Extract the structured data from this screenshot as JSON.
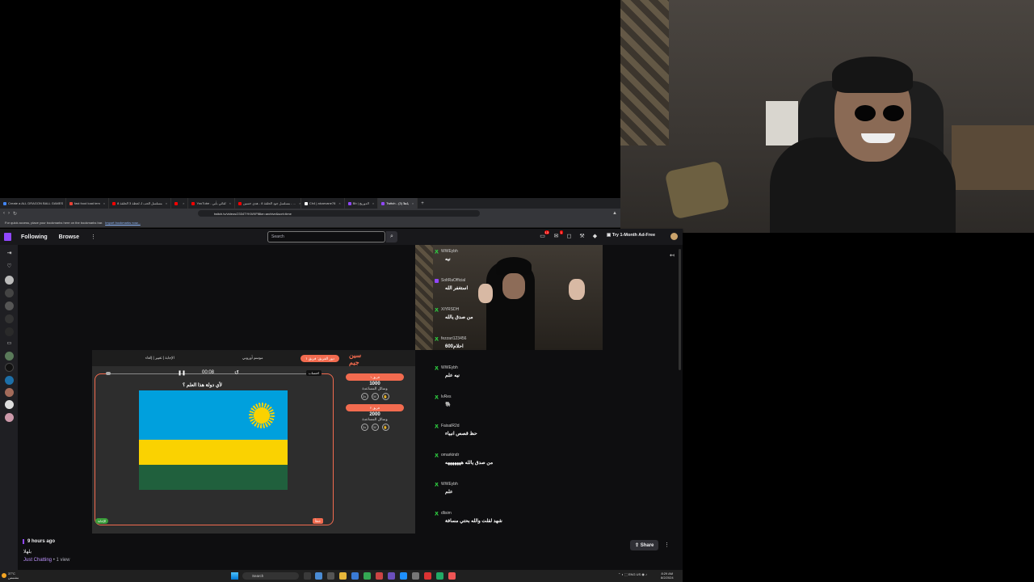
{
  "browser": {
    "tabs": [
      {
        "label": "Create a ALL DRAGON BALL GAMES",
        "color": "#4285f4",
        "active": false
      },
      {
        "label": "fast food load tem",
        "color": "#e94235",
        "active": false
      },
      {
        "label": "مسلسل الحب لـ لحظة 3 الحلقة 8",
        "color": "#ff0000",
        "active": false
      },
      {
        "label": "",
        "color": "#ff0000",
        "active": false
      },
      {
        "label": "YouTube - لقائي بأبي",
        "color": "#ff0000",
        "active": false
      },
      {
        "label": "مسلسل جود الحلقة 8 - هدى حسين - ...",
        "color": "#ff0000",
        "active": false
      },
      {
        "label": "Ch4 | alcarvane78",
        "color": "#ffffff",
        "active": false
      },
      {
        "label": "Bb | الدوريج",
        "color": "#9147ff",
        "active": false
      },
      {
        "label": "Twitch - ياهلا (3)",
        "color": "#9147ff",
        "active": true
      }
    ],
    "url": "twitch.tv/videos/2334TYKWXFf8ke=archive&sort=time",
    "bookmark_hint": "For quick access, place your bookmarks here on the bookmarks bar.",
    "bookmark_link": "Import bookmarks now..."
  },
  "twitch": {
    "nav_following": "Following",
    "nav_browse": "Browse",
    "more_icon": "⋮",
    "search_placeholder": "Search",
    "notif_count_1": "13",
    "notif_count_2": "1",
    "adfree": "Try 1-Month Ad-Free",
    "brand_color": "#9147ff"
  },
  "game": {
    "logo": "سين جيم",
    "turn_pill": "دور الفريق: فريق ١",
    "episode": "موسم أوروبي",
    "options": "الإجابة | تغيير | إلغاء",
    "timer": "00:08",
    "timer_btn": "احتساب",
    "question": "لأي دولة هذا العلم ؟",
    "tag_left": "الإجابة",
    "tag_right": "خطأ",
    "teams": [
      {
        "name": "فريق ١",
        "score": "1000",
        "aid": "وسائل المساعدة"
      },
      {
        "name": "فريق ٢",
        "score": "2000",
        "aid": "وسائل المساعدة"
      }
    ],
    "accent": "#f26b4f"
  },
  "chat": [
    {
      "user": "WWEybh",
      "text": "نيه",
      "badge": "green"
    },
    {
      "user": "SoltRaOfficial",
      "text": "استغفر الله",
      "badge": "purple"
    },
    {
      "user": "XIYRSDH",
      "text": "من صدق يالله",
      "badge": "green"
    },
    {
      "user": "fezzari123456",
      "text": "احلام600",
      "badge": "green"
    },
    {
      "user": "WWEybh",
      "text": "نيه علم",
      "badge": "green"
    },
    {
      "user": "lvRes",
      "text": "🐘",
      "badge": "green"
    },
    {
      "user": "FaisalR2d",
      "text": "حظ قصص انبياء",
      "badge": "green"
    },
    {
      "user": "omarkindr",
      "text": "من صدق يالله هههههههه",
      "badge": "green"
    },
    {
      "user": "WWEybh",
      "text": "علم",
      "badge": "green"
    },
    {
      "user": "dlisim",
      "text": "شهد لقلت والله بحتي مسافة",
      "badge": "green"
    }
  ],
  "video_info": {
    "time_ago": "9 hours ago",
    "title": "يلهلا",
    "category": "Just Chatting",
    "views": " • 1 view",
    "share": "Share",
    "more": "⋮"
  },
  "taskbar": {
    "weather_temp": "37°C",
    "weather_desc": "مشمس",
    "search": "Search",
    "lang": "ENG US",
    "time": "8:29 AM",
    "date": "8/2/2024"
  }
}
